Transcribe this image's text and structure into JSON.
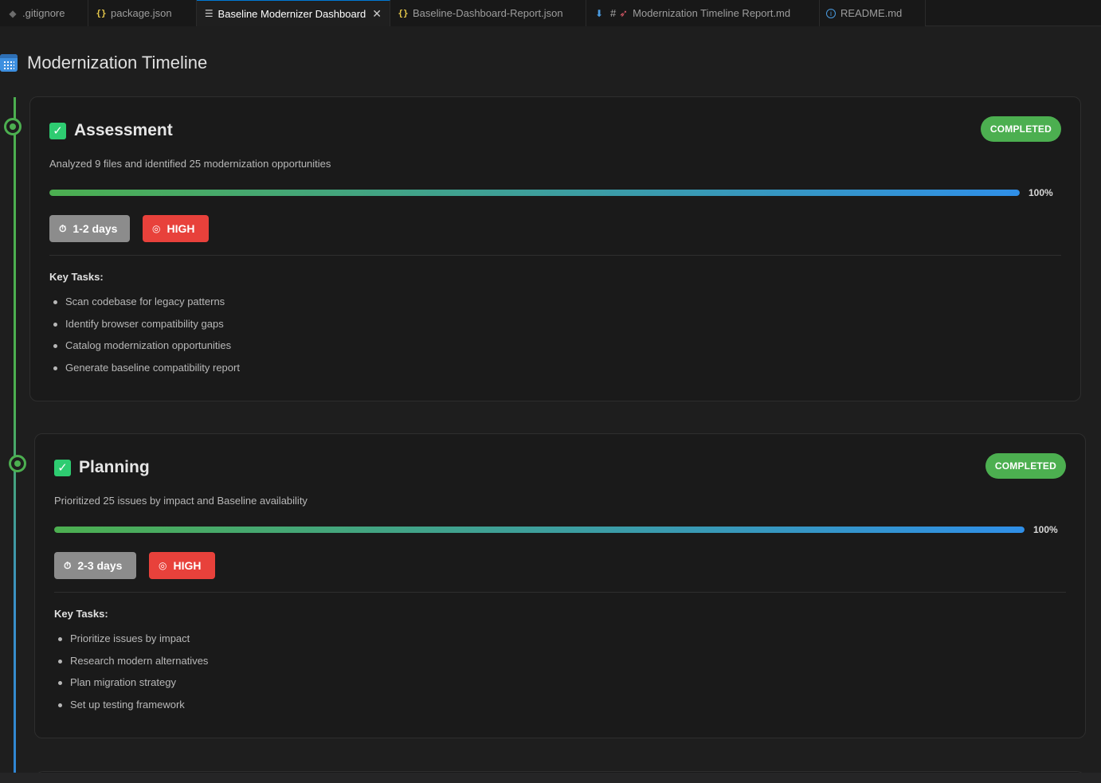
{
  "tabs": [
    {
      "label": ".gitignore",
      "icon": "git-icon",
      "active": false
    },
    {
      "label": "package.json",
      "icon": "json-icon",
      "active": false
    },
    {
      "label": "Baseline Modernizer Dashboard",
      "icon": "preview-icon",
      "active": true
    },
    {
      "label": "Baseline-Dashboard-Report.json",
      "icon": "json-icon",
      "active": false
    },
    {
      "label": "Modernization Timeline Report.md",
      "icon": "markdown-icon",
      "active": false
    },
    {
      "label": "README.md",
      "icon": "info-icon",
      "active": false
    }
  ],
  "page": {
    "title": "Modernization Timeline"
  },
  "colors": {
    "completed": "#4caf50",
    "high": "#e8413b",
    "duration": "#8c8c8c",
    "progress_start": "#4caf50",
    "progress_end": "#2f8fe8"
  },
  "phases": [
    {
      "title": "Assessment",
      "status": "COMPLETED",
      "description": "Analyzed 9 files and identified 25 modernization opportunities",
      "progress": 100,
      "progress_label": "100%",
      "duration": "1-2 days",
      "priority": "HIGH",
      "tasks_title": "Key Tasks:",
      "tasks": [
        "Scan codebase for legacy patterns",
        "Identify browser compatibility gaps",
        "Catalog modernization opportunities",
        "Generate baseline compatibility report"
      ]
    },
    {
      "title": "Planning",
      "status": "COMPLETED",
      "description": "Prioritized 25 issues by impact and Baseline availability",
      "progress": 100,
      "progress_label": "100%",
      "duration": "2-3 days",
      "priority": "HIGH",
      "tasks_title": "Key Tasks:",
      "tasks": [
        "Prioritize issues by impact",
        "Research modern alternatives",
        "Plan migration strategy",
        "Set up testing framework"
      ]
    }
  ]
}
